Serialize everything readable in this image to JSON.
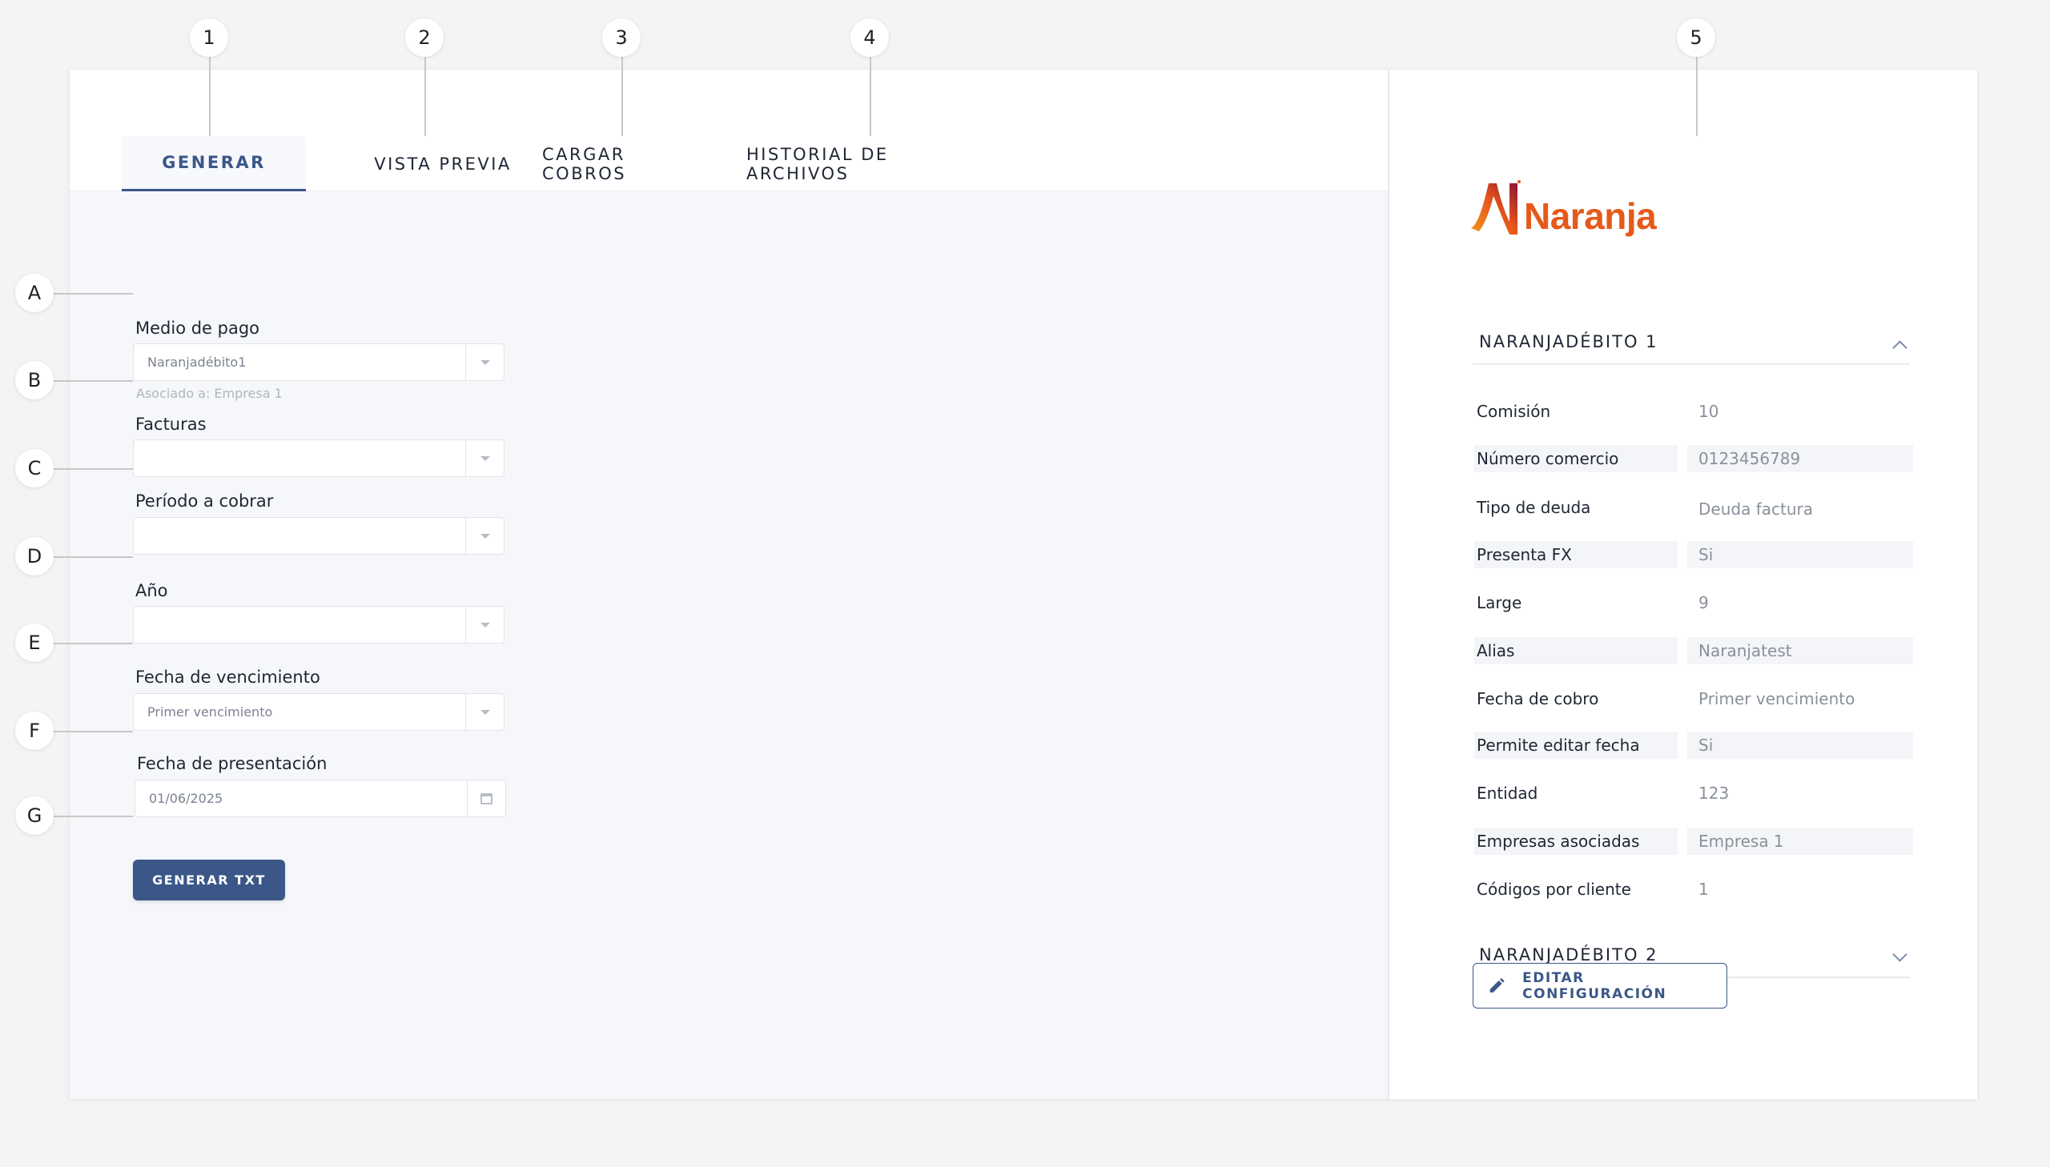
{
  "callouts": {
    "numbers": [
      "1",
      "2",
      "3",
      "4",
      "5"
    ],
    "letters": [
      "A",
      "B",
      "C",
      "D",
      "E",
      "F",
      "G"
    ]
  },
  "tabs": [
    {
      "label": "GENERAR",
      "active": true
    },
    {
      "label": "VISTA PREVIA",
      "active": false
    },
    {
      "label": "CARGAR COBROS",
      "active": false
    },
    {
      "label": "HISTORIAL DE ARCHIVOS",
      "active": false
    }
  ],
  "form": {
    "medio_pago": {
      "label": "Medio de pago",
      "value": "Naranjadébito1",
      "helper": "Asociado a: Empresa 1"
    },
    "facturas": {
      "label": "Facturas",
      "value": ""
    },
    "periodo": {
      "label": "Período a cobrar",
      "value": ""
    },
    "anio": {
      "label": "Año",
      "value": ""
    },
    "vencimiento": {
      "label": "Fecha de vencimiento",
      "value": "Primer vencimiento"
    },
    "presentacion": {
      "label": "Fecha de presentación",
      "value": "01/06/2025"
    },
    "submit_label": "GENERAR TXT"
  },
  "side": {
    "brand_name": "Naranja",
    "brand_color": "#e55a1b",
    "accordion1": {
      "title": "NARANJADÉBITO 1",
      "expanded": true,
      "rows": [
        {
          "label": "Comisión",
          "value": "10"
        },
        {
          "label": "Número comercio",
          "value": "0123456789"
        },
        {
          "label": "Tipo de deuda",
          "value": "Deuda factura"
        },
        {
          "label": "Presenta FX",
          "value": "Si"
        },
        {
          "label": "Large",
          "value": "9"
        },
        {
          "label": "Alias",
          "value": "Naranjatest"
        },
        {
          "label": "Fecha de cobro",
          "value": "Primer vencimiento"
        },
        {
          "label": "Permite editar fecha",
          "value": "Si"
        },
        {
          "label": "Entidad",
          "value": "123"
        },
        {
          "label": "Empresas asociadas",
          "value": "Empresa 1"
        },
        {
          "label": "Códigos por cliente",
          "value": "1"
        }
      ]
    },
    "accordion2": {
      "title": "NARANJADÉBITO 2",
      "expanded": false
    },
    "edit_label": "EDITAR CONFIGURACIÓN",
    "accent_color": "#3b5788"
  }
}
